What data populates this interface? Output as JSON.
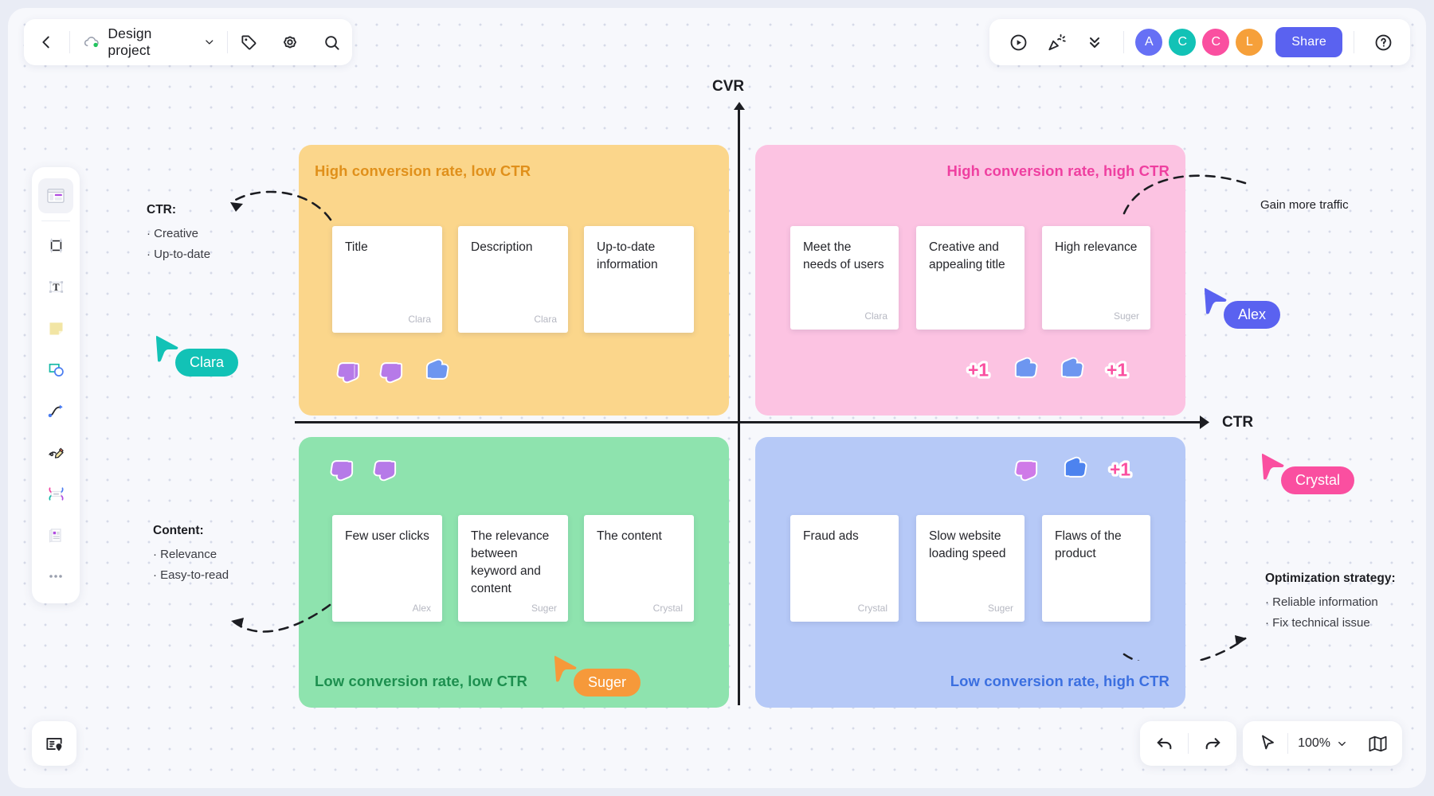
{
  "app": {
    "project_name": "Design project",
    "back_icon": "chevron-left-icon",
    "cloud_icon": "cloud-synced-icon",
    "dropdown_icon": "chevron-down-icon",
    "tag_icon": "tag-icon",
    "settings_icon": "gear-icon",
    "search_icon": "search-icon"
  },
  "topbar_right": {
    "present_icon": "play-circle-icon",
    "celebrate_icon": "party-popper-icon",
    "collapse_icon": "double-chevron-down-icon",
    "share_label": "Share",
    "help_icon": "question-circle-icon",
    "share_color": "#5a62f0",
    "avatars": [
      {
        "initial": "A",
        "color": "#6670f5",
        "name": "Alex"
      },
      {
        "initial": "C",
        "color": "#12c2b6",
        "name": "Clara"
      },
      {
        "initial": "C",
        "color": "#fa4fa0",
        "name": "Crystal"
      },
      {
        "initial": "L",
        "color": "#f6a03a",
        "name": "L"
      }
    ]
  },
  "toolbar_left": {
    "tools": [
      {
        "name": "template-tool",
        "icon": "template-icon",
        "selected": true
      },
      {
        "name": "frame-tool",
        "icon": "frame-icon",
        "selected": false
      },
      {
        "name": "text-tool",
        "icon": "text-t-icon",
        "selected": false
      },
      {
        "name": "sticky-note-tool",
        "icon": "sticky-note-icon",
        "selected": false
      },
      {
        "name": "shape-tool",
        "icon": "shapes-icon",
        "selected": false
      },
      {
        "name": "connector-tool",
        "icon": "curved-arrow-icon",
        "selected": false
      },
      {
        "name": "pen-tool",
        "icon": "pencil-scribble-icon",
        "selected": false
      },
      {
        "name": "mindmap-tool",
        "icon": "mindmap-icon",
        "selected": false
      },
      {
        "name": "document-tool",
        "icon": "document-icon",
        "selected": false
      },
      {
        "name": "more-tools",
        "icon": "more-dots-icon",
        "selected": false
      }
    ]
  },
  "bottombar": {
    "panel_icon": "map-list-panel-icon",
    "undo_icon": "undo-icon",
    "redo_icon": "redo-icon",
    "pointer_icon": "cursor-pointer-icon",
    "zoom_level": "100%",
    "zoom_dropdown_icon": "chevron-down-icon",
    "minimap_icon": "minimap-icon"
  },
  "board": {
    "axis": {
      "y_label": "CVR",
      "x_label": "CTR"
    },
    "quadrants": [
      {
        "id": "q-high-cvr-low-ctr",
        "title": "High conversion rate, low CTR",
        "bg": "#fbd68b",
        "title_color": "#e0901b",
        "title_align": "left",
        "cards": [
          {
            "text": "Title",
            "author": "Clara"
          },
          {
            "text": "Description",
            "author": "Clara"
          },
          {
            "text": "Up-to-date information",
            "author": ""
          }
        ],
        "reactions": [
          "thumbs-down-purple",
          "thumbs-down-purple",
          "thumbs-up-blue"
        ]
      },
      {
        "id": "q-high-cvr-high-ctr",
        "title": "High conversion rate, high CTR",
        "bg": "#fcc3e2",
        "title_color": "#ef3fa0",
        "title_align": "right",
        "cards": [
          {
            "text": "Meet the needs of users",
            "author": "Clara"
          },
          {
            "text": "Creative and appealing title",
            "author": ""
          },
          {
            "text": "High relevance",
            "author": "Suger"
          }
        ],
        "reactions": [
          "plus-one-pink",
          "thumbs-up-blue",
          "thumbs-up-blue",
          "plus-one-pink"
        ]
      },
      {
        "id": "q-low-cvr-low-ctr",
        "title": "Low conversion rate, low CTR",
        "bg": "#8ee3ae",
        "title_color": "#1d8f4f",
        "title_align": "left",
        "cards": [
          {
            "text": "Few user clicks",
            "author": "Alex"
          },
          {
            "text": "The relevance between keyword and content",
            "author": "Suger"
          },
          {
            "text": "The content",
            "author": "Crystal"
          }
        ],
        "reactions": [
          "thumbs-down-purple",
          "thumbs-down-purple"
        ]
      },
      {
        "id": "q-low-cvr-high-ctr",
        "title": "Low conversion rate, high CTR",
        "bg": "#b6c9f7",
        "title_color": "#3b6fe0",
        "title_align": "right",
        "cards": [
          {
            "text": "Fraud ads",
            "author": "Crystal"
          },
          {
            "text": "Slow website loading speed",
            "author": "Suger"
          },
          {
            "text": "Flaws of the product",
            "author": ""
          }
        ],
        "reactions": [
          "thumbs-down-purple",
          "thumbs-up-blue",
          "plus-one-pink"
        ]
      }
    ],
    "annotations": [
      {
        "id": "anno-ctr",
        "heading": "CTR:",
        "items": [
          "· Creative",
          "· Up-to-date"
        ]
      },
      {
        "id": "anno-content",
        "heading": "Content:",
        "items": [
          "· Relevance",
          "· Easy-to-read"
        ]
      },
      {
        "id": "anno-optimization",
        "heading": "Optimization strategy:",
        "items": [
          "· Reliable information",
          "· Fix technical issue"
        ]
      }
    ],
    "note_gain_traffic": "Gain more traffic",
    "cursors": [
      {
        "name": "Clara",
        "color": "#12c2b6"
      },
      {
        "name": "Alex",
        "color": "#5a62f0"
      },
      {
        "name": "Crystal",
        "color": "#fa4fa0"
      },
      {
        "name": "Suger",
        "color": "#f6993a"
      }
    ]
  }
}
